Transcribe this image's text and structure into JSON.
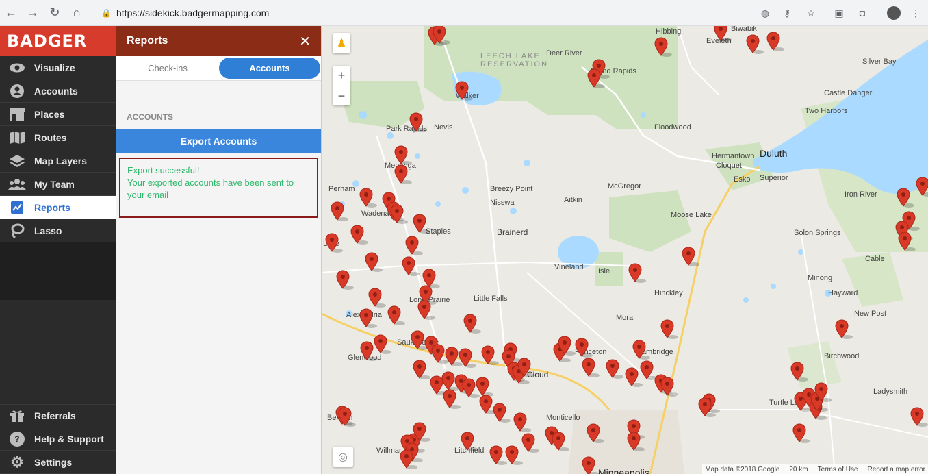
{
  "browser": {
    "url": "https://sidekick.badgermapping.com"
  },
  "sidebar": {
    "logo": "BADGER",
    "items": [
      {
        "label": "Visualize",
        "icon": "eye-icon"
      },
      {
        "label": "Accounts",
        "icon": "account-icon"
      },
      {
        "label": "Places",
        "icon": "store-icon"
      },
      {
        "label": "Routes",
        "icon": "map-icon"
      },
      {
        "label": "Map Layers",
        "icon": "layers-icon"
      },
      {
        "label": "My Team",
        "icon": "team-icon"
      },
      {
        "label": "Reports",
        "icon": "reports-icon"
      },
      {
        "label": "Lasso",
        "icon": "lasso-icon"
      }
    ],
    "bottom_items": [
      {
        "label": "Referrals",
        "icon": "gift-icon"
      },
      {
        "label": "Help & Support",
        "icon": "help-icon"
      },
      {
        "label": "Settings",
        "icon": "gear-icon"
      }
    ]
  },
  "panel": {
    "title": "Reports",
    "tabs": [
      "Check-ins",
      "Accounts"
    ],
    "section_label": "ACCOUNTS",
    "export_button": "Export Accounts",
    "message_line1": "Export successful!",
    "message_line2": "Your exported accounts have been sent to your email"
  },
  "map": {
    "reservation": "LEECH LAKE\nRESERVATION",
    "labels": [
      "Deer River",
      "Grand Rapids",
      "Hibbing",
      "Eveleth",
      "Biwabik",
      "Walker",
      "Nevis",
      "Park Rapids",
      "Menahga",
      "Breezy Point",
      "Nisswa",
      "Aitkin",
      "McGregor",
      "Floodwood",
      "Hermantown",
      "Cloquet",
      "Esko",
      "Superior",
      "Duluth",
      "Two Harbors",
      "Castle Danger",
      "Silver Bay",
      "Iron River",
      "Perham",
      "Wadena",
      "Staples",
      "Brainerd",
      "Moose Lake",
      "Solon Springs",
      "Cable",
      "Vineland",
      "Isle",
      "Little Falls",
      "Hinckley",
      "Minong",
      "Hayward",
      "Long Prairie",
      "Alexandria",
      "Mora",
      "New Post",
      "Sauk Centre",
      "Glenwood",
      "St. Cloud",
      "Princeton",
      "Cambridge",
      "Birchwood",
      "Turtle Lake",
      "Ladysmith",
      "Monticello",
      "Litchfield",
      "Benson",
      "Willmar",
      "Minneapolis",
      "Lake"
    ],
    "attribution": [
      "Map data ©2018 Google",
      "20 km",
      "Terms of Use",
      "Report a map error"
    ]
  }
}
